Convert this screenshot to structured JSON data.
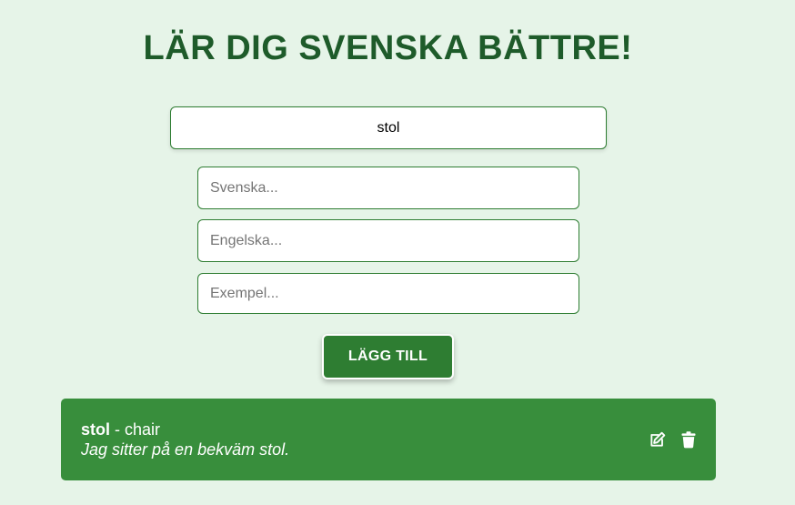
{
  "header": {
    "title": "LÄR DIG SVENSKA BÄTTRE!"
  },
  "search": {
    "value": "stol"
  },
  "form": {
    "swedish_placeholder": "Svenska...",
    "english_placeholder": "Engelska...",
    "example_placeholder": "Exempel...",
    "add_label": "LÄGG TILL"
  },
  "words": [
    {
      "swedish": "stol",
      "separator": " - ",
      "english": "chair",
      "example": "Jag sitter på en bekväm stol.",
      "edit_icon": "edit-icon",
      "delete_icon": "trash-icon"
    }
  ],
  "colors": {
    "background": "#e6f4e8",
    "title": "#1e5b2a",
    "accent": "#2e7d32",
    "card": "#388e3c"
  }
}
